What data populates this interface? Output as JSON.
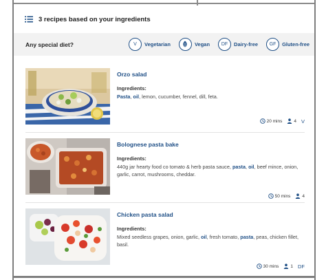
{
  "results": {
    "title": "3 recipes based on your ingredients",
    "icon": "list-icon"
  },
  "diet": {
    "prompt": "Any special diet?",
    "options": [
      {
        "badge": "V",
        "label": "Vegetarian"
      },
      {
        "badge": "",
        "label": "Vegan",
        "icon": "leaf-icon"
      },
      {
        "badge": "DF",
        "label": "Dairy-free"
      },
      {
        "badge": "GF",
        "label": "Gluten-free"
      }
    ]
  },
  "ingredients_label": "Ingredients:",
  "recipes": [
    {
      "title": "Orzo salad",
      "ingredients": [
        {
          "text": "Pasta",
          "match": true
        },
        {
          "text": ", "
        },
        {
          "text": "oil",
          "match": true
        },
        {
          "text": ", lemon, cucumber, fennel, dill, feta."
        }
      ],
      "time": "20 mins",
      "serves": "4",
      "tag": "V"
    },
    {
      "title": "Bolognese pasta bake",
      "ingredients": [
        {
          "text": "440g jar hearty food co tomato & herb pasta sauce, "
        },
        {
          "text": "pasta",
          "match": true
        },
        {
          "text": ", "
        },
        {
          "text": "oil",
          "match": true
        },
        {
          "text": ", beef mince, onion, garlic, carrot, mushrooms, cheddar."
        }
      ],
      "time": "50 mins",
      "serves": "4",
      "tag": ""
    },
    {
      "title": "Chicken pasta salad",
      "ingredients": [
        {
          "text": "Mixed seedless grapes, onion, garlic, "
        },
        {
          "text": "oil",
          "match": true
        },
        {
          "text": ", fresh tomato, "
        },
        {
          "text": "pasta",
          "match": true
        },
        {
          "text": ", peas, chicken fillet, basil."
        }
      ],
      "time": "30 mins",
      "serves": "1",
      "tag": "DF"
    }
  ],
  "colors": {
    "accent": "#1f4f86",
    "diet_bar": "#f2f2f2"
  }
}
